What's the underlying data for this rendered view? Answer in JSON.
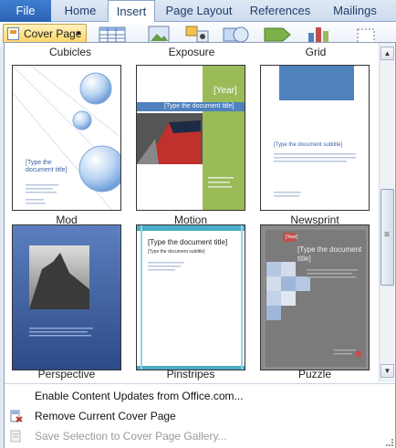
{
  "ribbon": {
    "tabs": [
      {
        "label": "File"
      },
      {
        "label": "Home"
      },
      {
        "label": "Insert"
      },
      {
        "label": "Page Layout"
      },
      {
        "label": "References"
      },
      {
        "label": "Mailings"
      }
    ],
    "active_tab": "Insert",
    "cover_page_button": "Cover Page"
  },
  "gallery": {
    "top_labels": [
      "Cubicles",
      "Exposure",
      "Grid"
    ],
    "items": [
      {
        "name": "Mod",
        "sample_title": "[Type the document title]"
      },
      {
        "name": "Motion",
        "sample_title": "[Type the document title]",
        "year": "[Year]"
      },
      {
        "name": "Newsprint",
        "sample_title": "[Type the document subtitle]"
      },
      {
        "name": "Perspective"
      },
      {
        "name": "Pinstripes",
        "sample_title": "[Type the document title]",
        "sample_subtitle": "[Type the document subtitle]"
      },
      {
        "name": "Puzzle",
        "sample_title": "[Type the document title]",
        "year": "[Year]"
      }
    ]
  },
  "menu": {
    "enable_updates": "Enable Content Updates from Office.com...",
    "remove_cover": "Remove Current Cover Page",
    "save_selection": "Save Selection to Cover Page Gallery..."
  },
  "colors": {
    "file_tab": "#2b62b2",
    "motion_green": "#9bbb59",
    "newsprint_blue": "#4f81bd",
    "perspective_blue": "#3a5c9a"
  }
}
